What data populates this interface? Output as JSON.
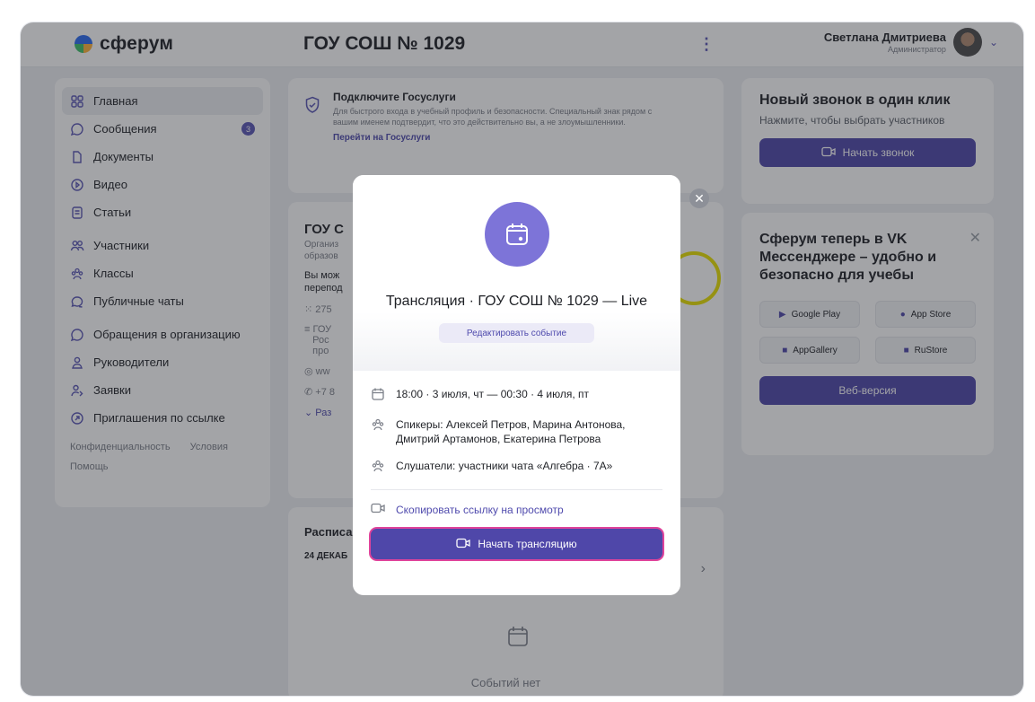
{
  "header": {
    "logo_text": "сферум",
    "school_title": "ГОУ СОШ № 1029",
    "menu_icon": "kebab-icon",
    "user_name": "Светлана Дмитриева",
    "user_role": "Администратор"
  },
  "sidebar": {
    "items": [
      {
        "label": "Главная",
        "icon": "home-icon",
        "active": true
      },
      {
        "label": "Сообщения",
        "icon": "chat-icon",
        "badge": "3"
      },
      {
        "label": "Документы",
        "icon": "document-icon"
      },
      {
        "label": "Видео",
        "icon": "play-icon"
      },
      {
        "label": "Статьи",
        "icon": "article-icon"
      },
      {
        "label": "Участники",
        "icon": "people-icon"
      },
      {
        "label": "Классы",
        "icon": "group-icon"
      },
      {
        "label": "Публичные чаты",
        "icon": "public-chat-icon"
      },
      {
        "label": "Обращения в организацию",
        "icon": "chat-icon"
      },
      {
        "label": "Руководители",
        "icon": "person-icon"
      },
      {
        "label": "Заявки",
        "icon": "person-add-icon"
      },
      {
        "label": "Приглашения по ссылке",
        "icon": "link-icon"
      }
    ],
    "footer": {
      "privacy": "Конфиденциальность",
      "terms": "Условия",
      "help": "Помощь"
    }
  },
  "gosuslugi": {
    "title": "Подключите Госуслуги",
    "description": "Для быстрого входа в учебный профиль и безопасности. Специальный знак рядом с вашим именем подтвердит, что это действительно вы, а не злоумышленники.",
    "link": "Перейти на Госуслуги"
  },
  "org": {
    "title": "ГОУ С",
    "subtitle_1": "Организ",
    "subtitle_2": "образов",
    "line_1": "Вы мож",
    "line_2": "перепод",
    "members": "275",
    "info_1": "ГОУ",
    "info_2": "Рос",
    "info_3": "про",
    "site": "ww",
    "phone": "+7 8",
    "more": "Раз"
  },
  "schedule": {
    "title": "Расписа",
    "date": "24 ДЕКАБ",
    "empty_text": "Событий нет"
  },
  "call_card": {
    "title": "Новый звонок в один клик",
    "description": "Нажмите, чтобы выбрать участников",
    "button": "Начать звонок"
  },
  "promo": {
    "title": "Сферум теперь в VK Мессенджере – удобно и безопасно для учебы",
    "stores": [
      "Google Play",
      "App Store",
      "AppGallery",
      "RuStore"
    ],
    "button": "Веб-версия"
  },
  "modal": {
    "title": "Трансляция · ГОУ СОШ № 1029 — Live",
    "edit_button": "Редактировать событие",
    "time": "18:00 · 3 июля, чт — 00:30 · 4 июля, пт",
    "speakers": "Спикеры: Алексей Петров, Марина Антонова, Дмитрий Артамонов, Екатерина Петрова",
    "listeners": "Слушатели: участники чата «Алгебра · 7А»",
    "copy_link": "Скопировать ссылку на просмотр",
    "start_button": "Начать трансляцию"
  },
  "colors": {
    "accent": "#4f47a9",
    "modal_icon_bg": "#7d74d8",
    "highlight": "#e0439b"
  }
}
